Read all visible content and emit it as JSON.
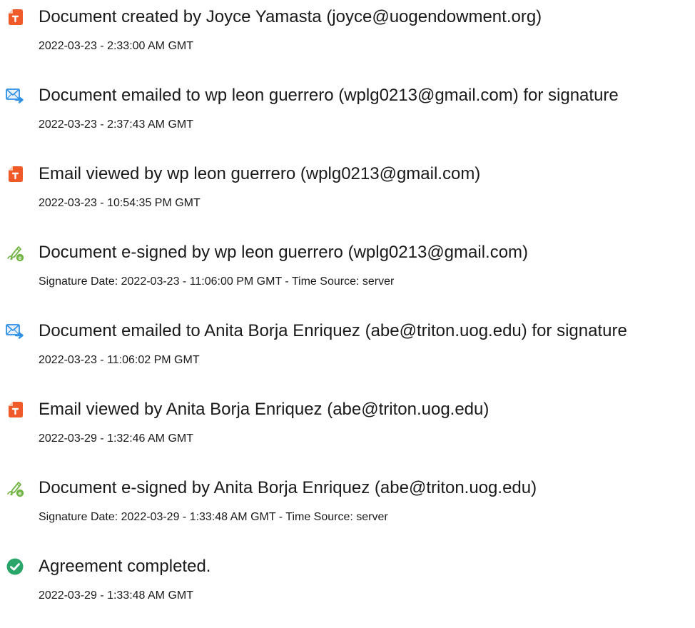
{
  "colors": {
    "doc_icon": "#f05a28",
    "email_icon": "#2d8fe5",
    "sign_icon": "#72b443",
    "complete_icon": "#2ba66a"
  },
  "events": [
    {
      "icon": "document-icon",
      "title": "Document created by Joyce Yamasta (joyce@uogendowment.org)",
      "subtitle": "2022-03-23 - 2:33:00 AM GMT"
    },
    {
      "icon": "email-send-icon",
      "title": "Document emailed to wp leon guerrero (wplg0213@gmail.com) for signature",
      "subtitle": "2022-03-23 - 2:37:43 AM GMT"
    },
    {
      "icon": "document-icon",
      "title": "Email viewed by wp leon guerrero (wplg0213@gmail.com)",
      "subtitle": "2022-03-23 - 10:54:35 PM GMT"
    },
    {
      "icon": "esign-pen-icon",
      "title": "Document e-signed by wp leon guerrero (wplg0213@gmail.com)",
      "subtitle": "Signature Date: 2022-03-23 - 11:06:00 PM GMT - Time Source: server"
    },
    {
      "icon": "email-send-icon",
      "title": "Document emailed to Anita Borja Enriquez (abe@triton.uog.edu) for signature",
      "subtitle": "2022-03-23 - 11:06:02 PM GMT"
    },
    {
      "icon": "document-icon",
      "title": "Email viewed by Anita Borja Enriquez (abe@triton.uog.edu)",
      "subtitle": "2022-03-29 - 1:32:46 AM GMT"
    },
    {
      "icon": "esign-pen-icon",
      "title": "Document e-signed by Anita Borja Enriquez (abe@triton.uog.edu)",
      "subtitle": "Signature Date: 2022-03-29 - 1:33:48 AM GMT - Time Source: server"
    },
    {
      "icon": "checkmark-circle-icon",
      "title": "Agreement completed.",
      "subtitle": "2022-03-29 - 1:33:48 AM GMT"
    }
  ]
}
